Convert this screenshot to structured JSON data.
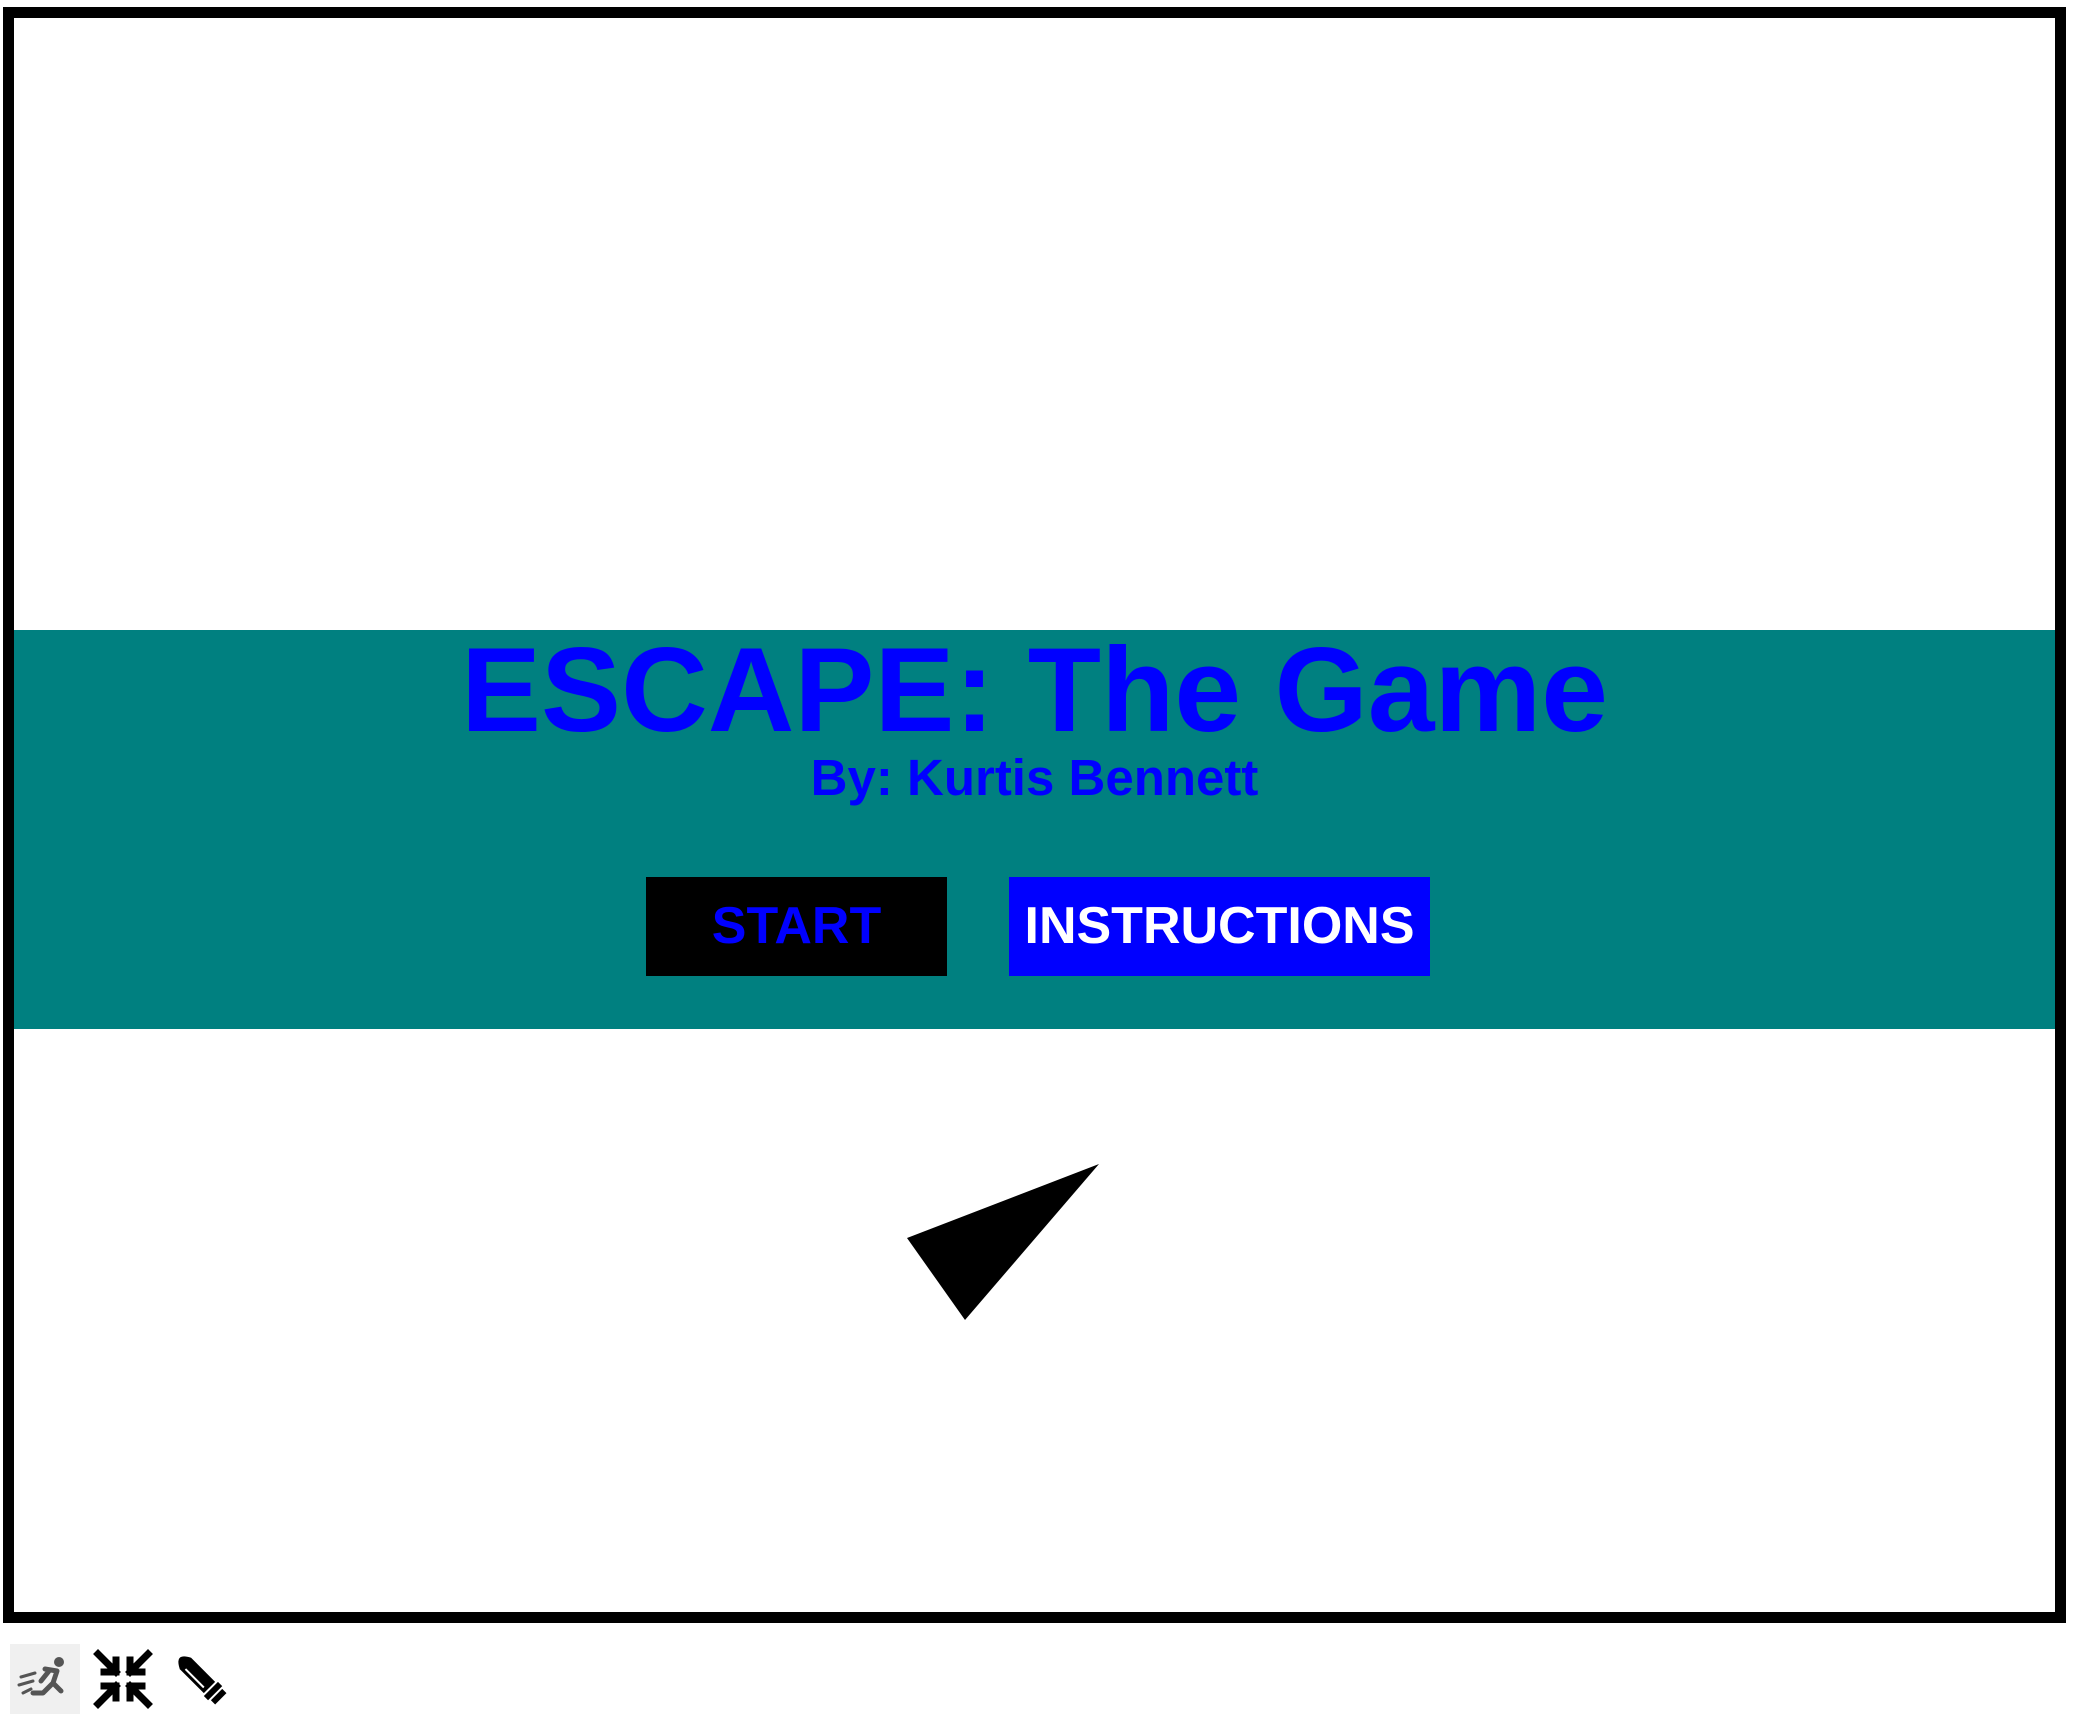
{
  "game": {
    "title": "ESCAPE: The Game",
    "subtitle": "By: Kurtis Bennett",
    "buttons": {
      "start_label": "START",
      "instructions_label": "INSTRUCTIONS"
    }
  },
  "colors": {
    "banner": "#008080",
    "title_text": "#0000ff",
    "start_bg": "#000000",
    "start_text": "#0000ff",
    "instructions_bg": "#0000ff",
    "instructions_text": "#ffffff",
    "frame_border": "#000000",
    "player": "#000000"
  },
  "toolbar": {
    "icons": [
      "run-icon",
      "collapse-icon",
      "bullet-icon"
    ]
  }
}
